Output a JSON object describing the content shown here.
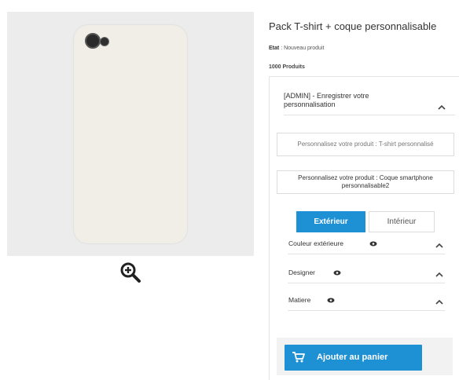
{
  "product": {
    "title": "Pack T-shirt + coque personnalisable",
    "state_label": "Etat",
    "state_value": ": Nouveau produit",
    "stock": "1000 Produits"
  },
  "admin": {
    "title": "[ADMIN] - Enregistrer votre personnalisation"
  },
  "customize_buttons": [
    {
      "label": "Personnalisez votre produit : T-shirt personnalisé"
    },
    {
      "label": "Personnalisez votre produit : Coque smartphone personnalisable2"
    }
  ],
  "tabs": [
    {
      "label": "Extérieur",
      "active": true
    },
    {
      "label": "Intérieur",
      "active": false
    }
  ],
  "options": [
    {
      "label": "Couleur extérieure"
    },
    {
      "label": "Designer"
    },
    {
      "label": "Matiere"
    }
  ],
  "cart": {
    "label": "Ajouter au panier"
  },
  "icons": {
    "zoom": "zoom-in-icon",
    "eye": "eye-icon",
    "chevron": "chevron-up-icon",
    "cart": "cart-icon"
  },
  "colors": {
    "accent": "#1e90d4",
    "preview_bg": "#ececec",
    "case_color": "#f1eee8"
  }
}
